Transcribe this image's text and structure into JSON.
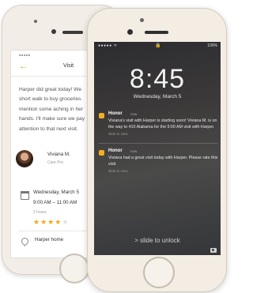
{
  "back_phone": {
    "header": {
      "back_glyph": "←",
      "title": "Visit"
    },
    "status_signal": "●●●●●",
    "message_lines": [
      "Harper did great today! We",
      "short walk to buy groceries.",
      "mention some aching in her",
      "hands. I'll make sure we pay",
      "attention to that next visit."
    ],
    "caregiver": {
      "name": "Viviana M.",
      "role": "Care Pro"
    },
    "schedule": {
      "date": "Wednesday, March 5",
      "time": "9:00 AM – 11:00 AM",
      "duration": "2 hours",
      "rating": 4,
      "max_rating": 5
    },
    "location": "Harper home"
  },
  "front_phone": {
    "status": {
      "signal": "●●●●● ᯤ",
      "lock": "🔒",
      "battery": "100%"
    },
    "time": "8:45",
    "date": "Wednesday, March 5",
    "notifications": [
      {
        "app": "Honor",
        "when": "now",
        "body": "Viviana's visit with Harper is starting soon! Viviana M. is on the way to 410 Alabama for the 9:00 AM visit with Harper.",
        "hint": "slide to view"
      },
      {
        "app": "Honor",
        "when": "now",
        "body": "Viviana had a great visit today with Harper. Please rate this visit.",
        "hint": "slide to view"
      }
    ],
    "slide_text": "> slide to unlock"
  },
  "colors": {
    "accent": "#f2b01e",
    "star": "#f0a81a"
  }
}
